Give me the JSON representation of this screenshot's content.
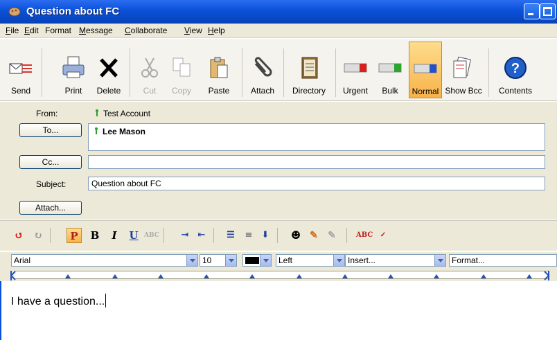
{
  "window": {
    "title": "Question about FC"
  },
  "menu": [
    {
      "label": "File",
      "accel": "F",
      "rest": "ile"
    },
    {
      "label": "Edit",
      "accel": "E",
      "rest": "dit"
    },
    {
      "label": "Format",
      "accel": "",
      "rest": "Format"
    },
    {
      "label": "Message",
      "accel": "M",
      "rest": "essage"
    },
    {
      "label": "Collaborate",
      "accel": "C",
      "rest": "ollaborate"
    },
    {
      "label": "View",
      "accel": "V",
      "rest": "iew"
    },
    {
      "label": "Help",
      "accel": "H",
      "rest": "elp"
    }
  ],
  "toolbar": {
    "send": "Send",
    "print": "Print",
    "delete": "Delete",
    "cut": "Cut",
    "copy": "Copy",
    "paste": "Paste",
    "attach": "Attach",
    "directory": "Directory",
    "urgent": "Urgent",
    "bulk": "Bulk",
    "normal": "Normal",
    "show_bcc": "Show Bcc",
    "contents": "Contents"
  },
  "header": {
    "from_label": "From:",
    "from_value": "Test Account",
    "to_button": "To...",
    "to_value": "Lee Mason",
    "cc_button": "Cc...",
    "cc_value": "",
    "subject_label": "Subject:",
    "subject_value": "Question about FC",
    "attach_button": "Attach..."
  },
  "format": {
    "font": "Arial",
    "size": "10",
    "align": "Left",
    "insert": "Insert...",
    "format": "Format..."
  },
  "body": {
    "text": "I have a question..."
  },
  "colors": {
    "title_blue": "#0a50d8",
    "toolbar_active": "#f7b34a",
    "panel": "#ece9d8"
  }
}
